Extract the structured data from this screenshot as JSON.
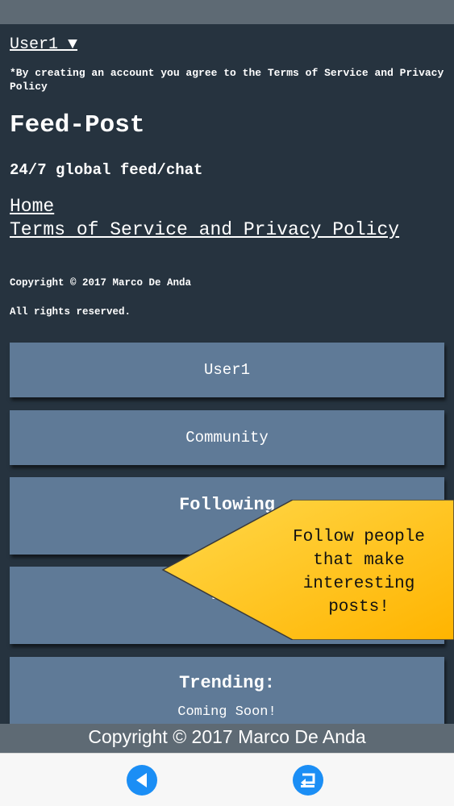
{
  "header": {
    "user_menu": "User1 ▼",
    "disclaimer": "*By creating an account you agree to the Terms of Service and Privacy Policy",
    "brand": "Feed-Post",
    "tagline": "24/7 global feed/chat"
  },
  "nav": {
    "home": "Home",
    "terms": "Terms of Service and Privacy Policy"
  },
  "legal": {
    "copyright": "Copyright © 2017 Marco De Anda",
    "rights": "All rights reserved."
  },
  "menu": {
    "user": "User1",
    "community": "Community",
    "following": "Following",
    "followers_partial": "Fol",
    "trending": "Trending:",
    "trending_sub": "Coming Soon!"
  },
  "tooltip": {
    "text": "Follow people that make interesting posts!",
    "color": "#ffc21a"
  },
  "footer": {
    "copyright": "Copyright © 2017 Marco De Anda"
  },
  "toolbar": {
    "back_icon": "back-arrow-icon",
    "return_icon": "return-icon",
    "accent": "#1b8ef5"
  }
}
